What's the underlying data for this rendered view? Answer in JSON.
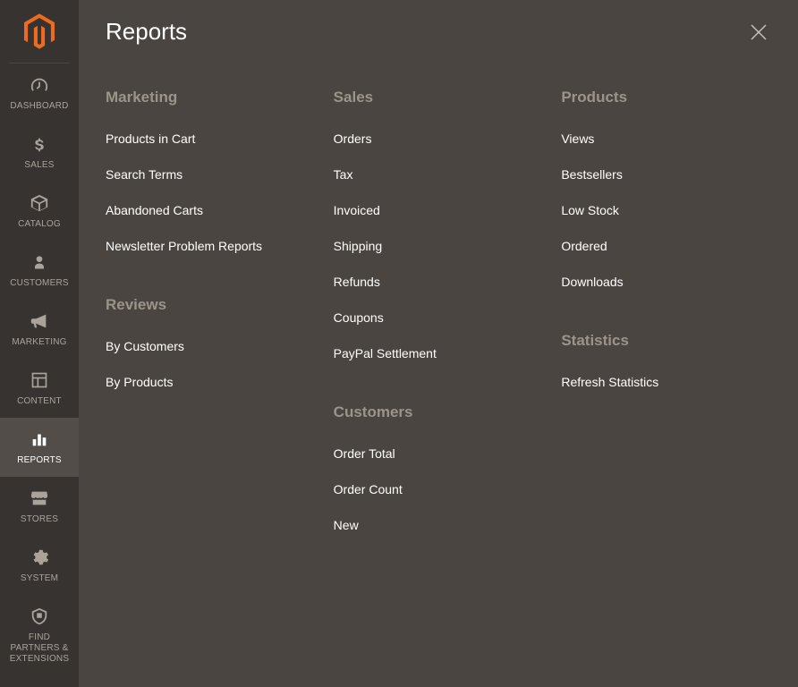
{
  "sidebar": {
    "items": [
      {
        "id": "dashboard",
        "label": "DASHBOARD"
      },
      {
        "id": "sales",
        "label": "SALES"
      },
      {
        "id": "catalog",
        "label": "CATALOG"
      },
      {
        "id": "customers",
        "label": "CUSTOMERS"
      },
      {
        "id": "marketing",
        "label": "MARKETING"
      },
      {
        "id": "content",
        "label": "CONTENT"
      },
      {
        "id": "reports",
        "label": "REPORTS"
      },
      {
        "id": "stores",
        "label": "STORES"
      },
      {
        "id": "system",
        "label": "SYSTEM"
      },
      {
        "id": "partners",
        "label": "FIND PARTNERS & EXTENSIONS"
      }
    ],
    "active": "reports"
  },
  "panel": {
    "title": "Reports",
    "columns": [
      {
        "sections": [
          {
            "heading": "Marketing",
            "links": [
              "Products in Cart",
              "Search Terms",
              "Abandoned Carts",
              "Newsletter Problem Reports"
            ]
          },
          {
            "heading": "Reviews",
            "links": [
              "By Customers",
              "By Products"
            ]
          }
        ]
      },
      {
        "sections": [
          {
            "heading": "Sales",
            "links": [
              "Orders",
              "Tax",
              "Invoiced",
              "Shipping",
              "Refunds",
              "Coupons",
              "PayPal Settlement"
            ]
          },
          {
            "heading": "Customers",
            "links": [
              "Order Total",
              "Order Count",
              "New"
            ]
          }
        ]
      },
      {
        "sections": [
          {
            "heading": "Products",
            "links": [
              "Views",
              "Bestsellers",
              "Low Stock",
              "Ordered",
              "Downloads"
            ]
          },
          {
            "heading": "Statistics",
            "links": [
              "Refresh Statistics"
            ]
          }
        ]
      }
    ]
  }
}
